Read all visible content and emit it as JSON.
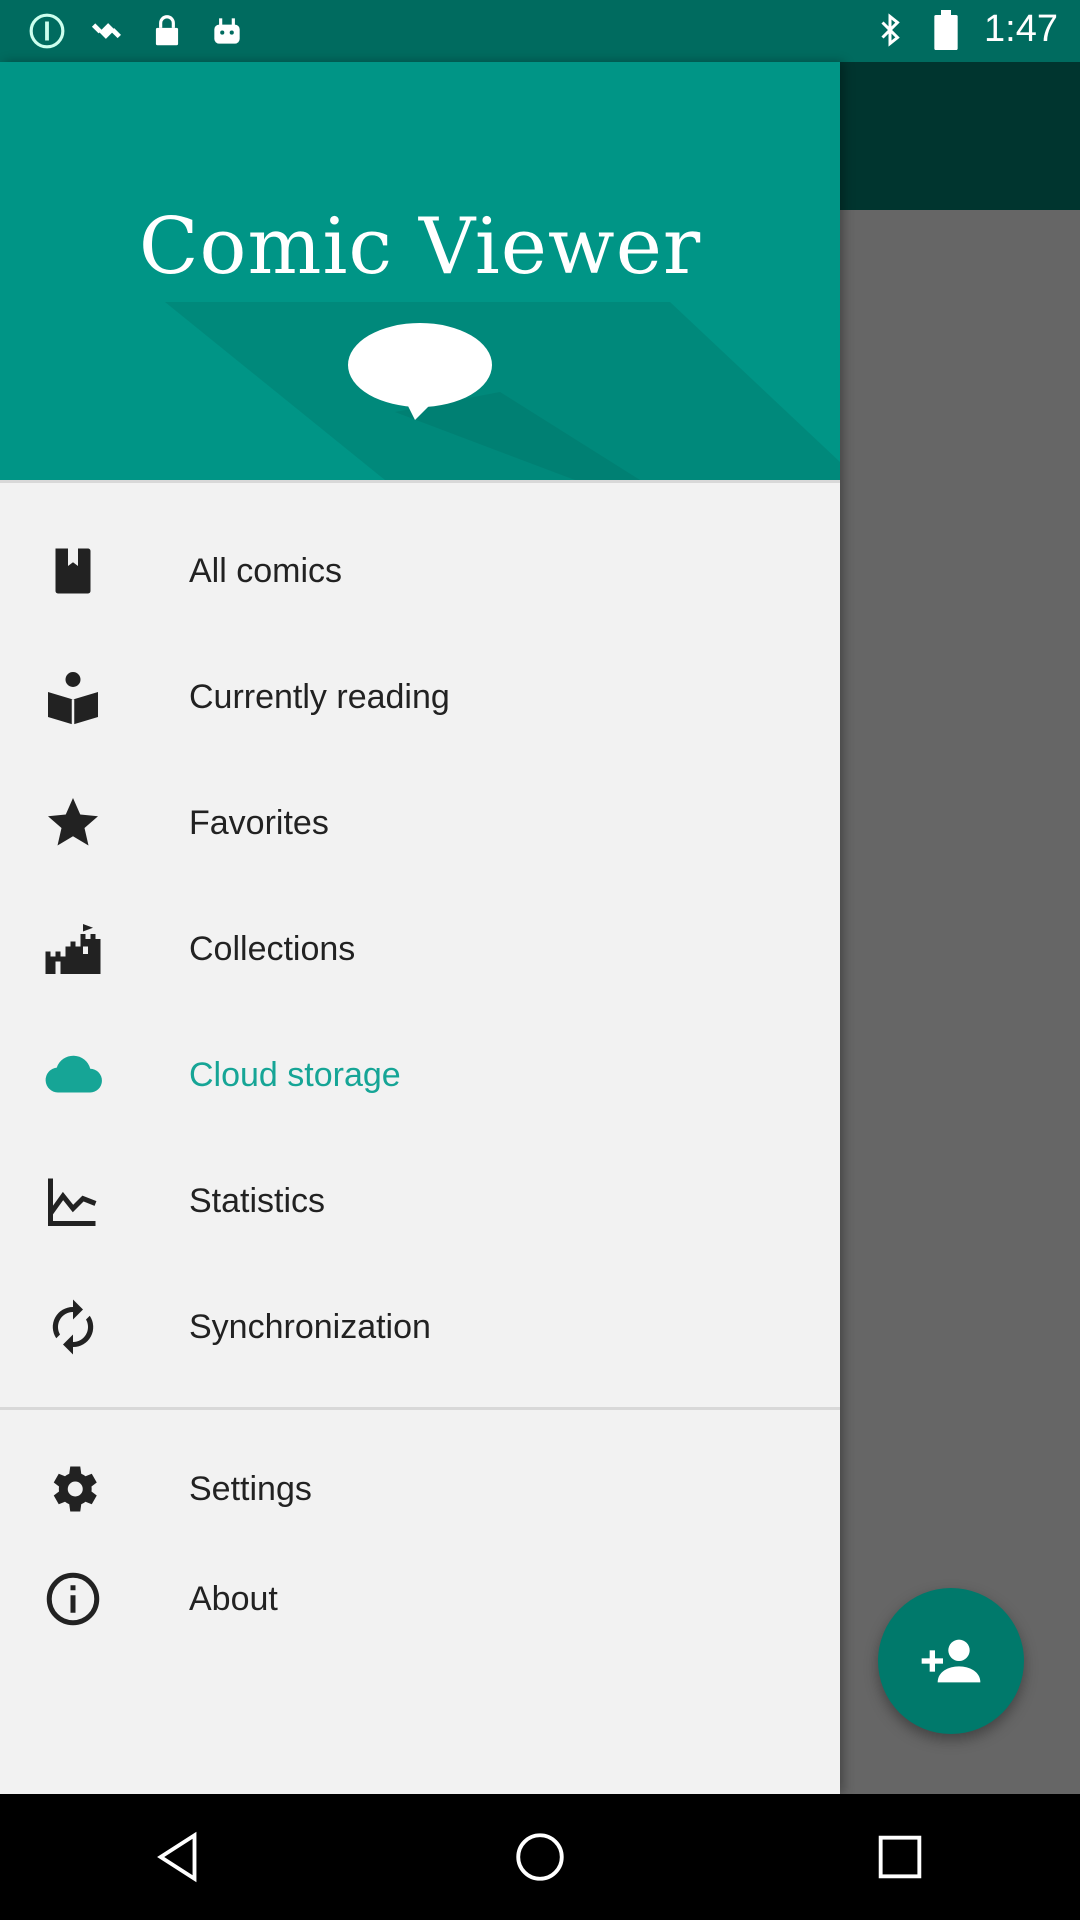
{
  "status_bar": {
    "time": "1:47",
    "icons_left": [
      "info-icon",
      "fake-gps-icon",
      "lock-icon",
      "android-icon"
    ],
    "icons_right": [
      "bluetooth-icon",
      "battery-icon"
    ]
  },
  "drawer": {
    "header": {
      "app_name": "Comic Viewer",
      "accent_color": "#009586"
    },
    "items": [
      {
        "label": "All comics",
        "icon": "book-icon"
      },
      {
        "label": "Currently reading",
        "icon": "reading-icon"
      },
      {
        "label": "Favorites",
        "icon": "star-icon"
      },
      {
        "label": "Collections",
        "icon": "castle-icon"
      },
      {
        "label": "Cloud storage",
        "icon": "cloud-icon",
        "active": true,
        "color": "#16a596"
      },
      {
        "label": "Statistics",
        "icon": "chart-icon"
      },
      {
        "label": "Synchronization",
        "icon": "sync-icon"
      }
    ],
    "secondary_items": [
      {
        "label": "Settings",
        "icon": "gear-icon"
      },
      {
        "label": "About",
        "icon": "info-icon"
      }
    ]
  },
  "fab": {
    "icon": "add-person-icon",
    "color": "#00796b"
  },
  "nav_bar": [
    "back-icon",
    "home-icon",
    "recents-icon"
  ]
}
